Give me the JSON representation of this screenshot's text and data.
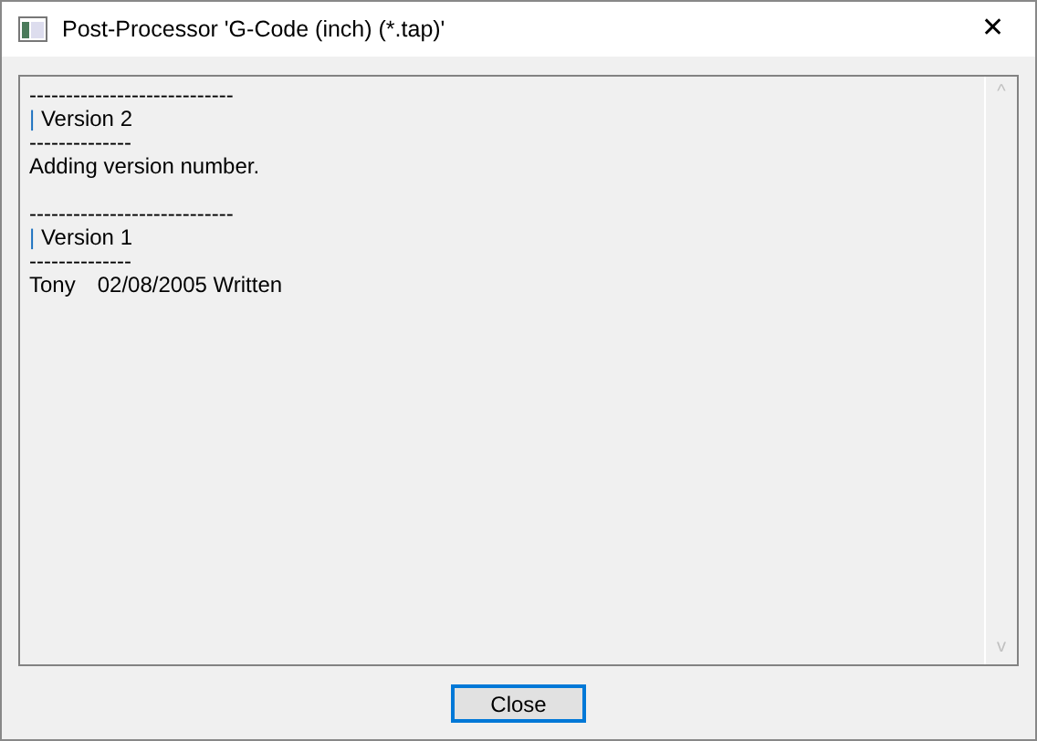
{
  "window": {
    "title": "Post-Processor 'G-Code (inch) (*.tap)'",
    "close": "✕"
  },
  "log": [
    {
      "lines": [
        {
          "kind": "rule",
          "text": "----------------------------"
        },
        {
          "kind": "heading",
          "bar": "|",
          "text": "Version 2"
        },
        {
          "kind": "rule",
          "text": "--------------"
        },
        {
          "kind": "text",
          "text": "Adding version number."
        }
      ]
    },
    {
      "lines": [
        {
          "kind": "rule",
          "text": "----------------------------"
        },
        {
          "kind": "heading",
          "bar": "|",
          "text": "Version 1"
        },
        {
          "kind": "rule",
          "text": "--------------"
        },
        {
          "kind": "entry",
          "author": "Tony",
          "text": "02/08/2005 Written"
        }
      ]
    }
  ],
  "scrollbar": {
    "up": "^",
    "down": "v"
  },
  "buttons": [
    {
      "label": "Close",
      "focused": true
    }
  ]
}
